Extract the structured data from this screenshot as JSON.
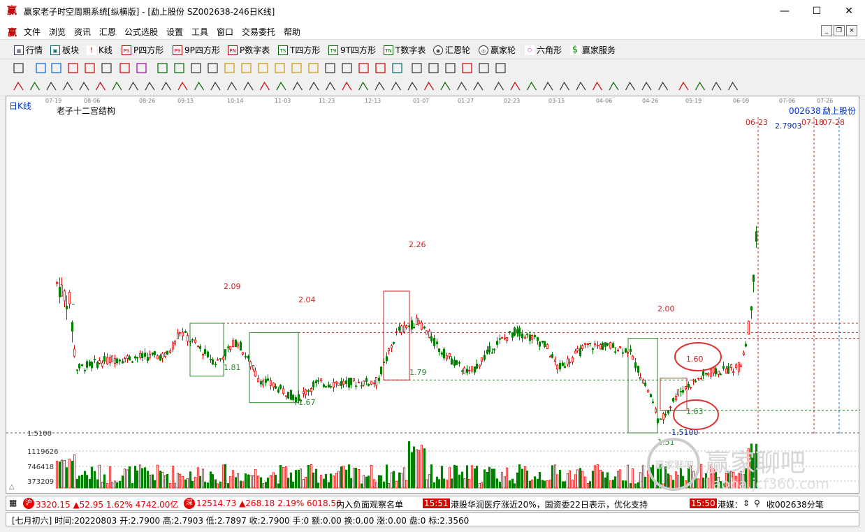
{
  "window": {
    "title": "赢家老子时空周期系统[纵横版] - [勐上股份   SZ002638-246日K线]",
    "app_icon": "赢"
  },
  "menu": [
    "文件",
    "浏览",
    "资讯",
    "汇恩",
    "公式选股",
    "设置",
    "工具",
    "窗口",
    "交易委托",
    "帮助"
  ],
  "toolbar1": [
    {
      "icon": "table-icon",
      "label": "行情"
    },
    {
      "icon": "grid-icon",
      "label": "板块"
    },
    {
      "icon": "kline-icon",
      "label": "K线"
    },
    {
      "icon": "ps-icon",
      "icon_text": "PS",
      "label": "P四方形"
    },
    {
      "icon": "p9-icon",
      "icon_text": "P9",
      "label": "9P四方形"
    },
    {
      "icon": "pn-icon",
      "icon_text": "PN",
      "label": "P数字表"
    },
    {
      "icon": "ts-icon",
      "icon_text": "TS",
      "label": "T四方形"
    },
    {
      "icon": "t9-icon",
      "icon_text": "T9",
      "label": "9T四方形"
    },
    {
      "icon": "tn-icon",
      "icon_text": "TN",
      "label": "T数字表"
    },
    {
      "icon": "wheel-icon",
      "label": "汇恩轮"
    },
    {
      "icon": "big-wheel-icon",
      "label": "赢家轮"
    },
    {
      "icon": "hexagon-icon",
      "label": "六角形"
    },
    {
      "icon": "dollar-icon",
      "label": "赢家服务"
    }
  ],
  "chart": {
    "period_label": "日K线",
    "indicator_name": "老子十二宫结构",
    "stock_code": "002638",
    "stock_name": "勐上股份",
    "date_ticks": [
      "07-19",
      "08-06",
      "08-26",
      "09-15",
      "10-14",
      "11-03",
      "11-23",
      "12-13",
      "01-07",
      "01-27",
      "02-23",
      "03-15",
      "04-06",
      "04-26",
      "05-19",
      "06-09",
      "07-06",
      "07-26"
    ],
    "future_dates": [
      "06-23",
      "07-18",
      "07-28"
    ],
    "price_labels": [
      "2.26",
      "2.09",
      "2.04",
      "2.00",
      "1.81",
      "1.79",
      "1.67",
      "1.63",
      "1.60",
      "1.51",
      "2.7903",
      "1.5100"
    ],
    "y_axis_price": "1.5100",
    "volume_ticks": [
      "1119626",
      "746418",
      "373209"
    ],
    "watermark": {
      "brand": "赢家聊吧",
      "url": "liaoba.jcf360.com",
      "seal": "赢家聊吧"
    },
    "colors": {
      "up": "#e00000",
      "down": "#008000",
      "future": "#1060c0"
    }
  },
  "chart_data": {
    "type": "candlestick",
    "title": "老子十二宫结构",
    "stock": "勐上股份 002638",
    "period": "日K线",
    "x_ticks": [
      "07-19",
      "08-06",
      "08-26",
      "09-15",
      "10-14",
      "11-03",
      "11-23",
      "12-13",
      "01-07",
      "01-27",
      "02-23",
      "03-15",
      "04-06",
      "04-26",
      "05-19",
      "06-09",
      "07-06",
      "07-26"
    ],
    "levels": [
      {
        "label": "2.26",
        "value": 2.26
      },
      {
        "label": "2.09",
        "value": 2.09
      },
      {
        "label": "2.04",
        "value": 2.04
      },
      {
        "label": "2.00",
        "value": 2.0
      },
      {
        "label": "1.81",
        "value": 1.81
      },
      {
        "label": "1.79",
        "value": 1.79
      },
      {
        "label": "1.67",
        "value": 1.67
      },
      {
        "label": "1.63",
        "value": 1.63
      },
      {
        "label": "1.60",
        "value": 1.6
      },
      {
        "label": "1.51",
        "value": 1.51
      }
    ],
    "last_price": 2.7903,
    "volume_axis": [
      1119626,
      746418,
      373209
    ]
  },
  "status1": {
    "sh_icon": "沪",
    "sh_index": "3320.15 ▲52.95 1.62% 4742.00亿",
    "sz_icon": "深",
    "sz_index": "12514.73 ▲268.18 2.19% 6018.56",
    "news1": "内入负面观察名单",
    "news_time1": "15:51",
    "news2": "港股华润医疗涨近20%，国资委22日表示，优化支持",
    "news_time2": "15:50",
    "news3": "港媒：",
    "collect": "收002638分笔"
  },
  "status2": {
    "text": "[七月初六] 时间:20220803 开:2.7900 高:2.7903 低:2.7897 收:2.7900 手:0 额:0.00 换:0.00 涨:0.00 盘:0 标:2.3560"
  }
}
